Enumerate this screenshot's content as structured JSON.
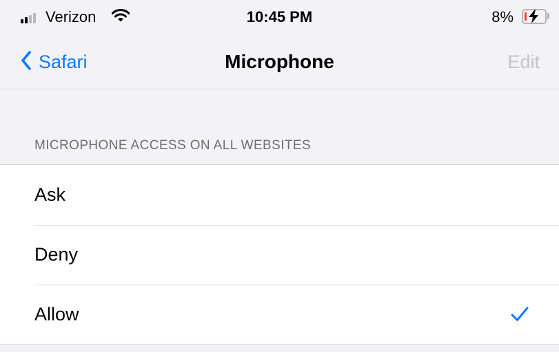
{
  "status_bar": {
    "carrier": "Verizon",
    "time": "10:45 PM",
    "battery_percent": "8%",
    "battery_level": 0.08,
    "signal_bars_active": 2,
    "signal_bars_total": 4,
    "charging": true,
    "icons": [
      "signal-icon",
      "wifi-icon",
      "battery-icon",
      "charging-bolt-icon"
    ]
  },
  "nav": {
    "back_label": "Safari",
    "title": "Microphone",
    "edit_label": "Edit",
    "back_icon": "chevron-left-icon"
  },
  "section": {
    "header": "MICROPHONE ACCESS ON ALL WEBSITES",
    "options": [
      {
        "label": "Ask",
        "selected": false
      },
      {
        "label": "Deny",
        "selected": false
      },
      {
        "label": "Allow",
        "selected": true
      }
    ],
    "check_icon": "checkmark-icon"
  },
  "colors": {
    "accent": "#0a7aff",
    "background": "#f2f2f7",
    "disabled_text": "#c4c4c9",
    "section_header_text": "#6d6d72",
    "battery_low": "#ff3b30"
  }
}
